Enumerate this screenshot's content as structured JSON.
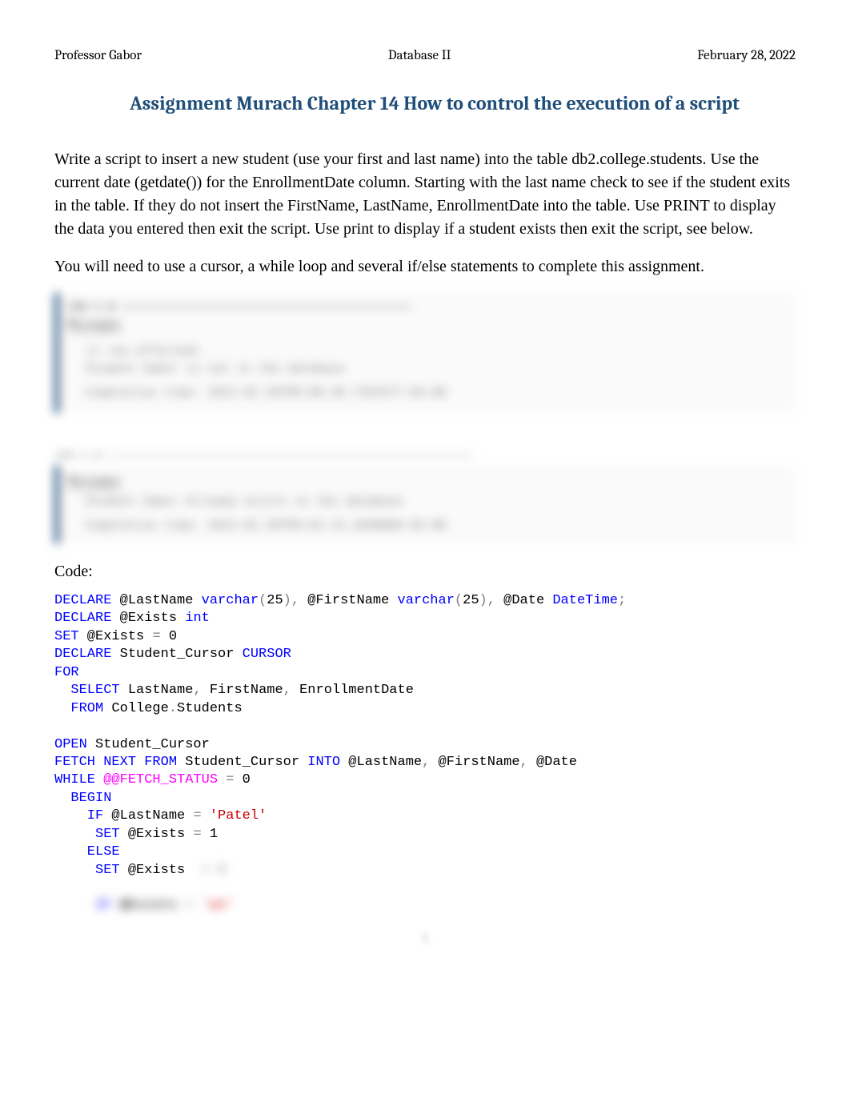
{
  "header": {
    "left": "Professor Gabor",
    "center": "Database II",
    "right": "February 28, 2022"
  },
  "title": "Assignment Murach Chapter 14 How to control the execution of a script",
  "paragraph1": "Write a script to insert a new student (use your first and last name) into the table db2.college.students. Use the current date (getdate()) for the EnrollmentDate column. Starting with the last name check to see if the student exits in the table. If they do not insert the FirstName, LastName, EnrollmentDate into the table. Use PRINT to display the data you entered then exit the script. Use print to display if a student exists then exit the script, see below.",
  "paragraph2": "You will need to use a cursor, a while loop and several if/else statements to complete this assignment.",
  "panel1": {
    "tab": "Messages",
    "rows": [
      "(1 row affected)",
      "Student Gabor is not in the database",
      "Completion time: 2022-02-28T09:00:30.7355577-05:00"
    ]
  },
  "panel2": {
    "tab": "Messages",
    "rows": [
      "Student Gabor Already exists in the database",
      "Completion time: 2022-02-28T09:01:15.2848060-05:00"
    ]
  },
  "code_label": "Code:",
  "code": {
    "l1_a": "DECLARE",
    "l1_b": " @LastName ",
    "l1_c": "varchar",
    "l1_d": "(",
    "l1_e": "25",
    "l1_f": ")",
    "l1_g": ",",
    "l1_h": " @FirstName ",
    "l1_i": "varchar",
    "l1_j": "(",
    "l1_k": "25",
    "l1_l": ")",
    "l1_m": ",",
    "l1_n": " @Date ",
    "l1_o": "DateTime",
    "l1_p": ";",
    "l2_a": "DECLARE",
    "l2_b": " @Exists ",
    "l2_c": "int",
    "l3_a": "SET",
    "l3_b": " @Exists ",
    "l3_c": "=",
    "l3_d": " 0",
    "l4_a": "DECLARE",
    "l4_b": " Student_Cursor ",
    "l4_c": "CURSOR",
    "l5_a": "FOR",
    "l6_a": "  SELECT",
    "l6_b": " LastName",
    "l6_c": ",",
    "l6_d": " FirstName",
    "l6_e": ",",
    "l6_f": " EnrollmentDate",
    "l7_a": "  FROM",
    "l7_b": " College",
    "l7_c": ".",
    "l7_d": "Students",
    "l8_blank": " ",
    "l9_a": "OPEN",
    "l9_b": " Student_Cursor",
    "l10_a": "FETCH",
    "l10_b": " NEXT",
    "l10_c": " FROM",
    "l10_d": " Student_Cursor ",
    "l10_e": "INTO",
    "l10_f": " @LastName",
    "l10_g": ",",
    "l10_h": " @FirstName",
    "l10_i": ",",
    "l10_j": " @Date",
    "l11_a": "WHILE",
    "l11_b": " @@FETCH_STATUS",
    "l11_c": " =",
    "l11_d": " 0",
    "l12_a": "  BEGIN",
    "l13_a": "    IF",
    "l13_b": " @LastName ",
    "l13_c": "=",
    "l13_d": " 'Patel'",
    "l14_a": "     SET",
    "l14_b": " @Exists ",
    "l14_c": "=",
    "l14_d": " 1",
    "l15_a": "    ELSE",
    "l16_a": "     SET",
    "l16_b": " @Exists",
    "blur1_a": "     IF",
    "blur1_b": " @Exists ",
    "blur1_c": "=",
    "blur1_d": " 'an'"
  },
  "page_number": "1"
}
